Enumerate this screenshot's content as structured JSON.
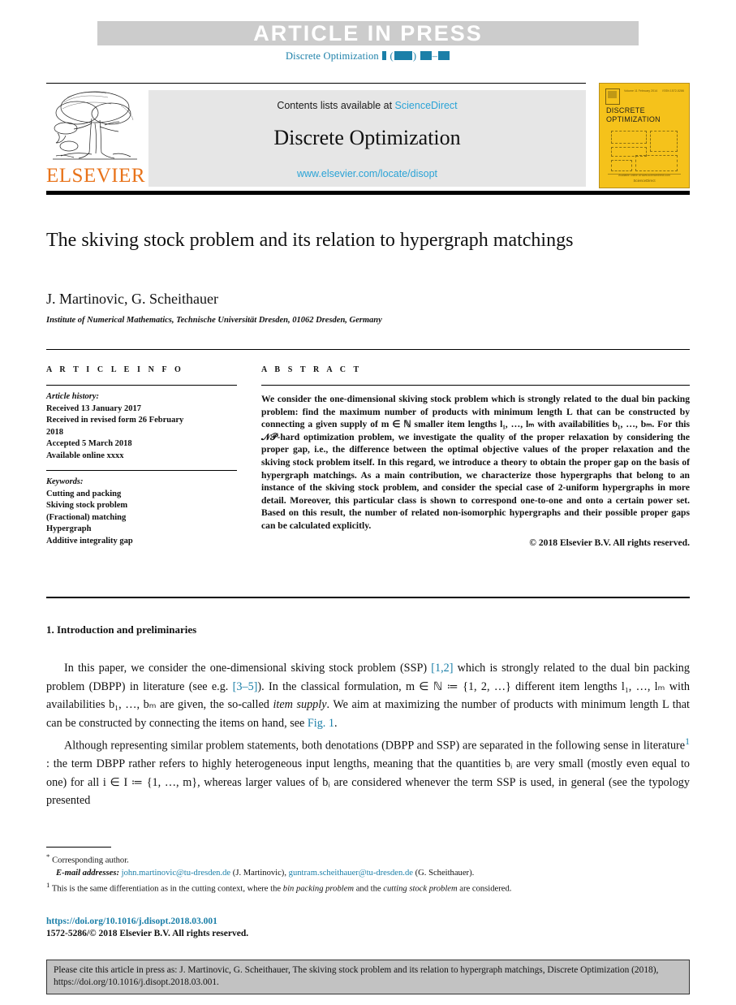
{
  "banner": {
    "text": "ARTICLE  IN  PRESS"
  },
  "running_head": {
    "journal": "Discrete Optimization"
  },
  "masthead": {
    "contents_prefix": "Contents lists available at ",
    "contents_link": "ScienceDirect",
    "journal_title": "Discrete Optimization",
    "journal_url": "www.elsevier.com/locate/disopt",
    "publisher": "ELSEVIER"
  },
  "cover": {
    "line_left": "Volume 11  February 2014",
    "line_right": "ISSN 1572-5286",
    "title_line1": "DISCRETE",
    "title_line2": "OPTIMIZATION",
    "footer_text": "Available online at www.sciencedirect.com",
    "footer_brand": "ScienceDirect"
  },
  "article": {
    "title": "The skiving stock problem and its relation to hypergraph matchings",
    "authors": "J. Martinovic, G. Scheithauer",
    "author_marker": "*",
    "affiliation": "Institute of Numerical Mathematics, Technische Universität Dresden, 01062 Dresden, Germany"
  },
  "info": {
    "heading": "A R T I C L E   I N F O",
    "history_label": "Article history:",
    "history": [
      "Received 13 January 2017",
      "Received in revised form 26 February",
      "2018",
      "Accepted 5 March 2018",
      "Available online xxxx"
    ],
    "keywords_label": "Keywords:",
    "keywords": [
      "Cutting and packing",
      "Skiving stock problem",
      "(Fractional) matching",
      "Hypergraph",
      "Additive integrality gap"
    ]
  },
  "abstract": {
    "heading": "A B S T R A C T",
    "body": "We consider the one-dimensional skiving stock problem which is strongly related to the dual bin packing problem: find the maximum number of products with minimum length L that can be constructed by connecting a given supply of m ∈ ℕ smaller item lengths l₁, …, lₘ with availabilities b₁, …, bₘ. For this 𝒩𝒫-hard optimization problem, we investigate the quality of the proper relaxation by considering the proper gap, i.e., the difference between the optimal objective values of the proper relaxation and the skiving stock problem itself. In this regard, we introduce a theory to obtain the proper gap on the basis of hypergraph matchings. As a main contribution, we characterize those hypergraphs that belong to an instance of the skiving stock problem, and consider the special case of 2-uniform hypergraphs in more detail. Moreover, this particular class is shown to correspond one-to-one and onto a certain power set. Based on this result, the number of related non-isomorphic hypergraphs and their possible proper gaps can be calculated explicitly.",
    "copyright": "© 2018 Elsevier B.V. All rights reserved."
  },
  "section": {
    "heading": "1. Introduction and preliminaries",
    "para1_a": "In this paper, we consider the one-dimensional skiving stock problem (SSP) ",
    "para1_ref1": "[1,2]",
    "para1_b": " which is strongly related to the dual bin packing problem (DBPP) in literature (see e.g. ",
    "para1_ref2": "[3–5]",
    "para1_c": "). In the classical formulation, m ∈ ℕ ≔ {1, 2, …} different item lengths l₁, …, lₘ with availabilities b₁, …, bₘ are given, the so-called ",
    "para1_italic": "item supply",
    "para1_d": ". We aim at maximizing the number of products with minimum length L that can be constructed by connecting the items on hand, see ",
    "para1_ref3": "Fig. 1",
    "para1_e": ".",
    "para2_a": "Although representing similar problem statements, both denotations (DBPP and SSP) are separated in the following sense in literature",
    "para2_sup": "1",
    "para2_b": " : the term DBPP rather refers to highly heterogeneous input lengths, meaning that the quantities bᵢ are very small (mostly even equal to one) for all i ∈ I ≔ {1, …, m}, whereas larger values of bᵢ are considered whenever the term SSP is used, in general (see the typology presented"
  },
  "footnotes": {
    "star_marker": "*",
    "star_text": "Corresponding author.",
    "email_label": "E-mail addresses:",
    "email1": "john.martinovic@tu-dresden.de",
    "email1_name": " (J. Martinovic), ",
    "email2": "guntram.scheithauer@tu-dresden.de",
    "email2_name": " (G. Scheithauer).",
    "fn1_marker": "1",
    "fn1_a": " This is the same differentiation as in the cutting context, where the ",
    "fn1_it1": "bin packing problem",
    "fn1_b": " and the ",
    "fn1_it2": "cutting stock problem",
    "fn1_c": " are considered."
  },
  "doi": {
    "url": "https://doi.org/10.1016/j.disopt.2018.03.001",
    "issn": "1572-5286/© 2018 Elsevier B.V. All rights reserved."
  },
  "cite": {
    "text": "Please cite this article in press as: J. Martinovic, G. Scheithauer, The skiving stock problem and its relation to hypergraph matchings, Discrete Optimization (2018), https://doi.org/10.1016/j.disopt.2018.03.001."
  },
  "colors": {
    "link": "#1b7fa8",
    "sd_link": "#2aa3d6",
    "banner_bg": "#cccccc",
    "cover_bg": "#f5c21b",
    "elsevier_orange": "#e8731a",
    "cite_bg": "#c2c2c2"
  }
}
